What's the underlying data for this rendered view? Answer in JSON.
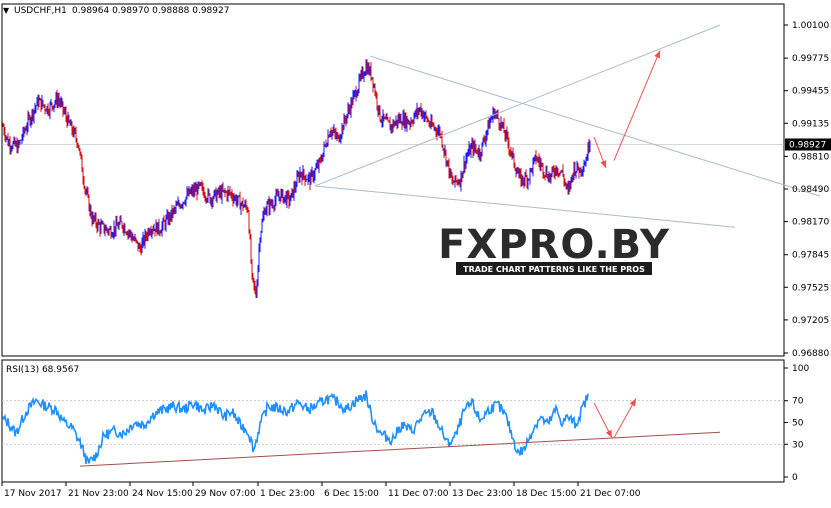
{
  "header": {
    "symbol_label": "USDCHF,H1",
    "ohlc_values": "0.98964 0.98970 0.98888 0.98927"
  },
  "rsi_panel": {
    "label": "RSI(13) 68.9567"
  },
  "watermark": {
    "brand": "FXPRO.BY",
    "tagline": "TRADE CHART PATTERNS LIKE THE PROS"
  },
  "colors": {
    "bull_candle": "#1a1aff",
    "bear_candle": "#d01010",
    "rsi_line": "#1e90ff",
    "trendline": "#a9bccd",
    "rsi_trendline": "#a05050",
    "arrow": "#f05050",
    "current_price_tag": "#000000"
  },
  "chart_data": [
    {
      "type": "candlestick",
      "symbol": "USDCHF",
      "timeframe": "H1",
      "current_price_label": "0.98927",
      "y_tick_labels": [
        "1.00100",
        "0.99775",
        "0.99455",
        "0.99135",
        "0.98810",
        "0.98490",
        "0.98170",
        "0.97845",
        "0.97525",
        "0.97205",
        "0.96880"
      ],
      "ylim": [
        0.9688,
        1.001
      ],
      "x_tick_labels": [
        "17 Nov 2017",
        "21 Nov 23:00",
        "24 Nov 15:00",
        "29 Nov 07:00",
        "1 Dec 23:00",
        "6 Dec 15:00",
        "11 Dec 07:00",
        "13 Dec 23:00",
        "18 Dec 15:00",
        "21 Dec 07:00"
      ],
      "price_path": [
        [
          0,
          0.992
        ],
        [
          8,
          0.9895
        ],
        [
          18,
          0.989
        ],
        [
          28,
          0.9915
        ],
        [
          38,
          0.9935
        ],
        [
          48,
          0.9928
        ],
        [
          58,
          0.9938
        ],
        [
          68,
          0.9915
        ],
        [
          78,
          0.9895
        ],
        [
          85,
          0.985
        ],
        [
          92,
          0.982
        ],
        [
          100,
          0.9812
        ],
        [
          110,
          0.9808
        ],
        [
          122,
          0.9815
        ],
        [
          130,
          0.9805
        ],
        [
          140,
          0.979
        ],
        [
          150,
          0.9812
        ],
        [
          160,
          0.981
        ],
        [
          170,
          0.9822
        ],
        [
          180,
          0.9835
        ],
        [
          190,
          0.9845
        ],
        [
          200,
          0.985
        ],
        [
          210,
          0.984
        ],
        [
          220,
          0.9845
        ],
        [
          230,
          0.9845
        ],
        [
          240,
          0.9835
        ],
        [
          248,
          0.983
        ],
        [
          252,
          0.976
        ],
        [
          256,
          0.9745
        ],
        [
          260,
          0.9805
        ],
        [
          265,
          0.983
        ],
        [
          272,
          0.9835
        ],
        [
          280,
          0.9843
        ],
        [
          290,
          0.9838
        ],
        [
          300,
          0.9865
        ],
        [
          310,
          0.9858
        ],
        [
          320,
          0.9875
        ],
        [
          330,
          0.9908
        ],
        [
          338,
          0.9898
        ],
        [
          348,
          0.9925
        ],
        [
          358,
          0.995
        ],
        [
          366,
          0.997
        ],
        [
          372,
          0.996
        ],
        [
          380,
          0.992
        ],
        [
          390,
          0.991
        ],
        [
          400,
          0.9918
        ],
        [
          410,
          0.9915
        ],
        [
          420,
          0.9928
        ],
        [
          430,
          0.9912
        ],
        [
          440,
          0.9905
        ],
        [
          446,
          0.988
        ],
        [
          452,
          0.9855
        ],
        [
          460,
          0.9858
        ],
        [
          466,
          0.988
        ],
        [
          472,
          0.989
        ],
        [
          480,
          0.9885
        ],
        [
          488,
          0.991
        ],
        [
          494,
          0.9925
        ],
        [
          500,
          0.9915
        ],
        [
          508,
          0.9895
        ],
        [
          514,
          0.9875
        ],
        [
          520,
          0.9858
        ],
        [
          528,
          0.986
        ],
        [
          536,
          0.988
        ],
        [
          544,
          0.9868
        ],
        [
          550,
          0.986
        ],
        [
          556,
          0.987
        ],
        [
          562,
          0.9865
        ],
        [
          568,
          0.9845
        ],
        [
          574,
          0.987
        ],
        [
          580,
          0.9868
        ],
        [
          586,
          0.9878
        ],
        [
          590,
          0.9898
        ]
      ],
      "trendlines": [
        {
          "from": [
            370,
            0.99795
          ],
          "to": [
            820,
            0.9842
          ]
        },
        {
          "from": [
            315,
            0.9852
          ],
          "to": [
            720,
            1.001
          ]
        },
        {
          "from": [
            315,
            0.9852
          ],
          "to": [
            735,
            0.98115
          ]
        }
      ],
      "arrows": [
        {
          "from": [
            594,
            0.99
          ],
          "to": [
            606,
            0.98695
          ]
        },
        {
          "from": [
            614,
            0.9877
          ],
          "to": [
            660,
            0.9985
          ]
        }
      ]
    },
    {
      "type": "line",
      "indicator": "RSI",
      "period": 13,
      "last_value": 68.9567,
      "y_tick_labels": [
        "100",
        "70",
        "50",
        "30",
        "0"
      ],
      "ylim": [
        0,
        100
      ],
      "levels": [
        30,
        70
      ],
      "values_path": [
        [
          0,
          55
        ],
        [
          8,
          50
        ],
        [
          16,
          40
        ],
        [
          26,
          60
        ],
        [
          36,
          70
        ],
        [
          46,
          65
        ],
        [
          56,
          62
        ],
        [
          64,
          50
        ],
        [
          72,
          45
        ],
        [
          80,
          32
        ],
        [
          88,
          12
        ],
        [
          96,
          20
        ],
        [
          104,
          38
        ],
        [
          114,
          42
        ],
        [
          124,
          40
        ],
        [
          134,
          50
        ],
        [
          144,
          48
        ],
        [
          154,
          58
        ],
        [
          164,
          62
        ],
        [
          174,
          65
        ],
        [
          184,
          62
        ],
        [
          194,
          68
        ],
        [
          204,
          60
        ],
        [
          214,
          67
        ],
        [
          224,
          55
        ],
        [
          232,
          60
        ],
        [
          240,
          48
        ],
        [
          248,
          42
        ],
        [
          254,
          25
        ],
        [
          260,
          48
        ],
        [
          268,
          65
        ],
        [
          278,
          63
        ],
        [
          288,
          60
        ],
        [
          298,
          68
        ],
        [
          308,
          62
        ],
        [
          318,
          66
        ],
        [
          326,
          72
        ],
        [
          336,
          70
        ],
        [
          346,
          62
        ],
        [
          356,
          70
        ],
        [
          366,
          75
        ],
        [
          372,
          55
        ],
        [
          380,
          40
        ],
        [
          392,
          34
        ],
        [
          402,
          48
        ],
        [
          412,
          42
        ],
        [
          422,
          55
        ],
        [
          432,
          60
        ],
        [
          440,
          45
        ],
        [
          448,
          30
        ],
        [
          456,
          38
        ],
        [
          464,
          60
        ],
        [
          472,
          68
        ],
        [
          480,
          52
        ],
        [
          490,
          63
        ],
        [
          498,
          66
        ],
        [
          506,
          55
        ],
        [
          512,
          38
        ],
        [
          518,
          22
        ],
        [
          524,
          25
        ],
        [
          532,
          42
        ],
        [
          540,
          55
        ],
        [
          548,
          48
        ],
        [
          556,
          62
        ],
        [
          562,
          50
        ],
        [
          568,
          55
        ],
        [
          576,
          48
        ],
        [
          582,
          62
        ],
        [
          588,
          75
        ]
      ],
      "trendline": {
        "from": [
          80,
          10
        ],
        "to": [
          720,
          41
        ]
      },
      "arrows": [
        {
          "from": [
            594,
            68
          ],
          "to": [
            612,
            36
          ]
        },
        {
          "from": [
            614,
            36
          ],
          "to": [
            636,
            72
          ]
        }
      ]
    }
  ]
}
